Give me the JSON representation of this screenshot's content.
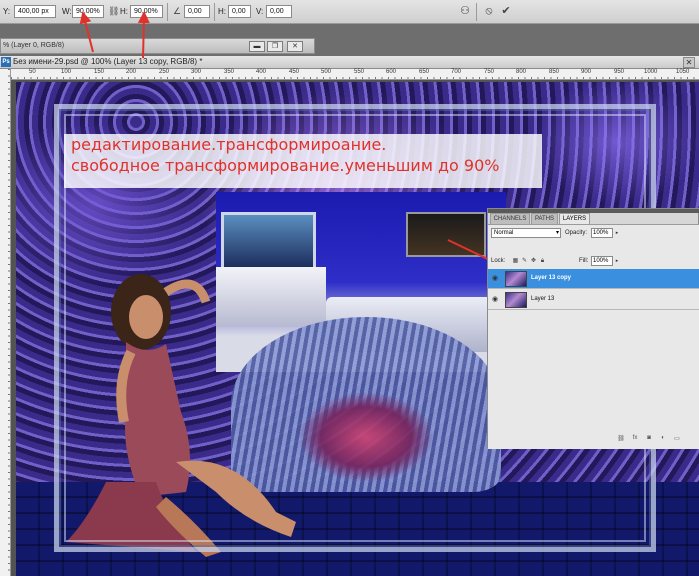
{
  "options_bar": {
    "y_label": "Y:",
    "y_value": "400,00 px",
    "w_label": "W:",
    "w_value": "90,00%",
    "h_label": "H:",
    "h_value": "90,00%",
    "angle_value": "0,00",
    "hskew_label": "H:",
    "hskew_value": "0,00",
    "vskew_label": "V:",
    "vskew_value": "0,00",
    "warp_icon": "warp-icon",
    "cancel_icon": "cancel-icon",
    "commit_icon": "commit-icon"
  },
  "inactive_tab": {
    "title": "% (Layer 0, RGB/8)"
  },
  "document": {
    "title": "Без имени-29.psd @ 100% (Layer 13 copy, RGB/8) *"
  },
  "ruler": {
    "ticks": [
      "50",
      "100",
      "150",
      "200",
      "250",
      "300",
      "350",
      "400",
      "450",
      "500",
      "550",
      "600",
      "650",
      "700",
      "750",
      "800",
      "850",
      "900",
      "950",
      "1000",
      "1050"
    ]
  },
  "overlay": {
    "line1": "редактирование.трансформироание.",
    "line2": "свободное трансформирование.уменьшим до 90%"
  },
  "layers_panel": {
    "tabs": [
      "CHANNELS",
      "PATHS",
      "LAYERS"
    ],
    "active_tab": "LAYERS",
    "blend_mode": "Normal",
    "opacity_label": "Opacity:",
    "opacity_value": "100%",
    "lock_label": "Lock:",
    "fill_label": "Fill:",
    "fill_value": "100%",
    "layers": [
      {
        "name": "Layer 13 copy",
        "selected": true
      },
      {
        "name": "Layer 13",
        "selected": false
      }
    ]
  },
  "colors": {
    "annotation_red": "#e0322a",
    "selection_blue": "#3a8fde"
  }
}
